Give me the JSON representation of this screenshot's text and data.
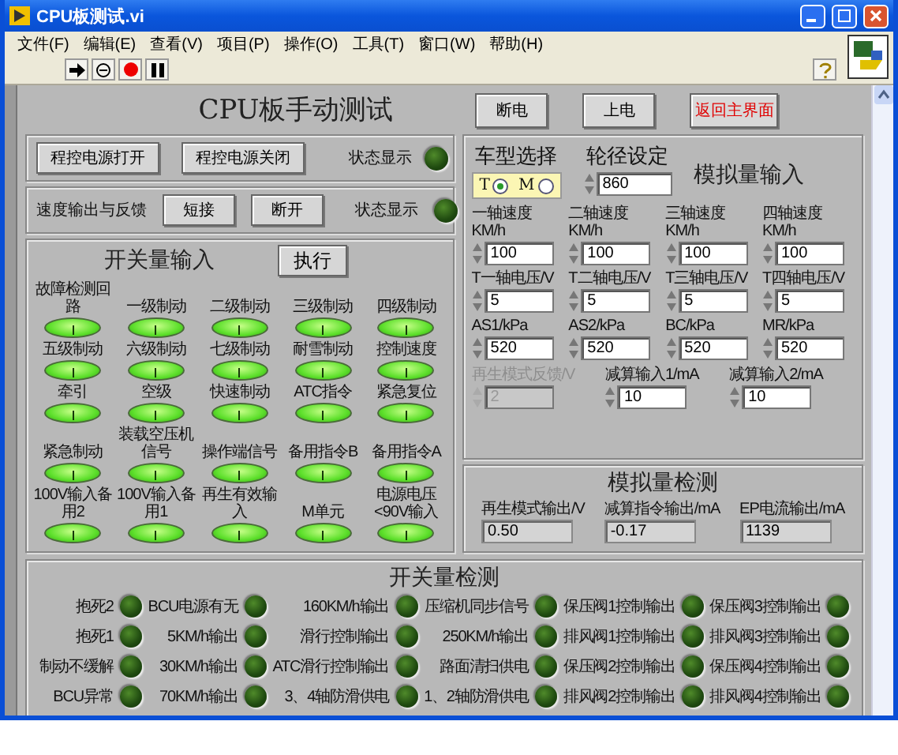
{
  "window": {
    "title": "CPU板测试.vi"
  },
  "menu": [
    "文件(F)",
    "编辑(E)",
    "查看(V)",
    "项目(P)",
    "操作(O)",
    "工具(T)",
    "窗口(W)",
    "帮助(H)"
  ],
  "header": {
    "title": "CPU板手动测试",
    "buttons": [
      {
        "label": "断电",
        "kind": "normal"
      },
      {
        "label": "上电",
        "kind": "normal"
      },
      {
        "label": "返回主界面",
        "kind": "warning"
      }
    ]
  },
  "power_control": {
    "buttons": [
      "程控电源打开",
      "程控电源关闭"
    ],
    "status": {
      "label": "状态显示",
      "on": false
    }
  },
  "speed_output": {
    "label": "速度输出与反馈",
    "buttons": [
      "短接",
      "断开"
    ],
    "status": {
      "label": "状态显示",
      "on": false
    }
  },
  "switch_inputs": {
    "title": "开关量输入",
    "execute": "执行",
    "items": [
      {
        "label": "故障检测回路",
        "on": true
      },
      {
        "label": "一级制动",
        "on": true
      },
      {
        "label": "二级制动",
        "on": true
      },
      {
        "label": "三级制动",
        "on": true
      },
      {
        "label": "四级制动",
        "on": true
      },
      {
        "label": "五级制动",
        "on": true
      },
      {
        "label": "六级制动",
        "on": true
      },
      {
        "label": "七级制动",
        "on": true
      },
      {
        "label": "耐雪制动",
        "on": true
      },
      {
        "label": "控制速度",
        "on": true
      },
      {
        "label": "牵引",
        "on": true
      },
      {
        "label": "空级",
        "on": true
      },
      {
        "label": "快速制动",
        "on": true
      },
      {
        "label": "ATC指令",
        "on": true
      },
      {
        "label": "紧急复位",
        "on": true
      },
      {
        "label": "紧急制动",
        "on": true
      },
      {
        "label": "装载空压机信号",
        "on": true
      },
      {
        "label": "操作端信号",
        "on": true
      },
      {
        "label": "备用指令B",
        "on": true
      },
      {
        "label": "备用指令A",
        "on": true
      },
      {
        "label": "100V输入备用2",
        "on": true
      },
      {
        "label": "100V输入备用1",
        "on": true
      },
      {
        "label": "再生有效输入",
        "on": true
      },
      {
        "label": "M单元",
        "on": true
      },
      {
        "label": "电源电压<90V输入",
        "on": true
      }
    ]
  },
  "analog_inputs": {
    "vehicle_type": {
      "label": "车型选择",
      "options": [
        {
          "label": "T",
          "selected": true
        },
        {
          "label": "M",
          "selected": false
        }
      ]
    },
    "wheel_diameter": {
      "label": "轮径设定",
      "value": "860"
    },
    "title": "模拟量输入",
    "fields": [
      {
        "label": "一轴速度KM/h",
        "value": "100"
      },
      {
        "label": "二轴速度KM/h",
        "value": "100"
      },
      {
        "label": "三轴速度KM/h",
        "value": "100"
      },
      {
        "label": "四轴速度KM/h",
        "value": "100"
      },
      {
        "label": "T一轴电压/V",
        "value": "5"
      },
      {
        "label": "T二轴电压/V",
        "value": "5"
      },
      {
        "label": "T三轴电压/V",
        "value": "5"
      },
      {
        "label": "T四轴电压/V",
        "value": "5"
      },
      {
        "label": "AS1/kPa",
        "value": "520"
      },
      {
        "label": "AS2/kPa",
        "value": "520"
      },
      {
        "label": "BC/kPa",
        "value": "520"
      },
      {
        "label": "MR/kPa",
        "value": "520"
      }
    ],
    "extra_fields": [
      {
        "label": "再生模式反馈/V",
        "value": "2",
        "disabled": true
      },
      {
        "label": "减算输入1/mA",
        "value": "10",
        "disabled": false
      },
      {
        "label": "减算输入2/mA",
        "value": "10",
        "disabled": false
      }
    ]
  },
  "analog_detect": {
    "title": "模拟量检测",
    "fields": [
      {
        "label": "再生模式输出/V",
        "value": "0.50"
      },
      {
        "label": "减算指令输出/mA",
        "value": "-0.17"
      },
      {
        "label": "EP电流输出/mA",
        "value": "1139"
      }
    ]
  },
  "switch_detect": {
    "title": "开关量检测",
    "items": [
      {
        "label": "抱死2",
        "on": false
      },
      {
        "label": "BCU电源有无",
        "on": false
      },
      {
        "label": "160KM/h输出",
        "on": false
      },
      {
        "label": "压缩机同步信号",
        "on": false
      },
      {
        "label": "保压阀1控制输出",
        "on": false
      },
      {
        "label": "保压阀3控制输出",
        "on": false
      },
      {
        "label": "抱死1",
        "on": false
      },
      {
        "label": "5KM/h输出",
        "on": false
      },
      {
        "label": "滑行控制输出",
        "on": false
      },
      {
        "label": "250KM/h输出",
        "on": false
      },
      {
        "label": "排风阀1控制输出",
        "on": false
      },
      {
        "label": "排风阀3控制输出",
        "on": false
      },
      {
        "label": "制动不缓解",
        "on": false
      },
      {
        "label": "30KM/h输出",
        "on": false
      },
      {
        "label": "ATC滑行控制输出",
        "on": false
      },
      {
        "label": "路面清扫供电",
        "on": false
      },
      {
        "label": "保压阀2控制输出",
        "on": false
      },
      {
        "label": "保压阀4控制输出",
        "on": false
      },
      {
        "label": "BCU异常",
        "on": false
      },
      {
        "label": "70KM/h输出",
        "on": false
      },
      {
        "label": "3、4轴防滑供电",
        "on": false
      },
      {
        "label": "1、2轴防滑供电",
        "on": false
      },
      {
        "label": "排风阀2控制输出",
        "on": false
      },
      {
        "label": "排风阀4控制输出",
        "on": false
      }
    ]
  }
}
